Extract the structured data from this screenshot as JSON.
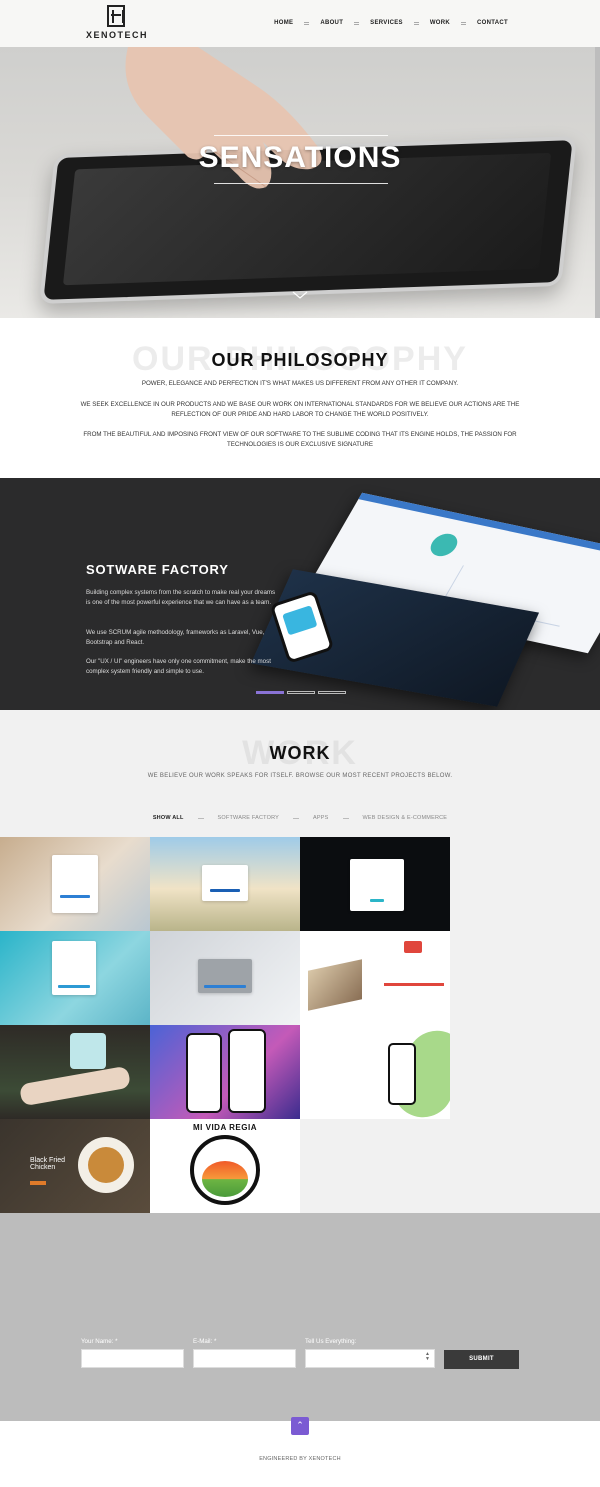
{
  "brand": {
    "name": "XENOTECH"
  },
  "nav": {
    "items": [
      {
        "label": "HOME"
      },
      {
        "label": "ABOUT"
      },
      {
        "label": "SERVICES"
      },
      {
        "label": "WORK"
      },
      {
        "label": "CONTACT"
      }
    ]
  },
  "hero": {
    "title": "SENSATIONS"
  },
  "philosophy": {
    "ghost": "OUR PHILOSOPHY",
    "title": "OUR PHILOSOPHY",
    "p1": "POWER, ELEGANCE AND PERFECTION IT'S WHAT MAKES US DIFFERENT FROM ANY OTHER IT COMPANY.",
    "p2": "WE SEEK EXCELLENCE IN OUR PRODUCTS AND WE BASE OUR WORK ON INTERNATIONAL STANDARDS FOR WE BELIEVE OUR ACTIONS ARE THE REFLECTION OF OUR PRIDE AND HARD LABOR TO CHANGE THE WORLD POSITIVELY.",
    "p3": "FROM THE BEAUTIFUL AND IMPOSING FRONT VIEW OF OUR SOFTWARE TO THE SUBLIME CODING THAT ITS ENGINE HOLDS, THE PASSION FOR TECHNOLOGIES IS OUR EXCLUSIVE SIGNATURE"
  },
  "factory": {
    "title": "SOTWARE FACTORY",
    "p1": "Building complex systems from the scratch to make real your dreams is one of the most powerful experience that we can have as a team.",
    "p2": "We use SCRUM agile methodology, frameworks as Laravel, Vue, Bootstrap and React.",
    "p3": "Our \"UX / UI\" engineers have only one commitment, make the most complex system friendly and simple to use."
  },
  "work": {
    "ghost": "WORK",
    "title": "WORK",
    "subtitle": "WE BELIEVE OUR WORK SPEAKS FOR ITSELF. BROWSE OUR MOST RECENT PROJECTS BELOW.",
    "filters": [
      {
        "label": "SHOW ALL"
      },
      {
        "label": "SOFTWARE FACTORY"
      },
      {
        "label": "APPS"
      },
      {
        "label": "WEB DESIGN & E-COMMERCE"
      }
    ],
    "tile_texts": {
      "chicken": "Black Fried Chicken",
      "mividaregia": "MI VIDA REGIA"
    }
  },
  "contact": {
    "name_label": "Your Name: *",
    "email_label": "E-Mail: *",
    "message_label": "Tell Us Everything:",
    "submit_label": "SUBMIT"
  },
  "footer": {
    "text": "ENGINEERED BY XENOTECH"
  },
  "colors": {
    "accent": "#7b5bd3",
    "dark": "#2b2b2c",
    "header": "#f7f7f5"
  }
}
